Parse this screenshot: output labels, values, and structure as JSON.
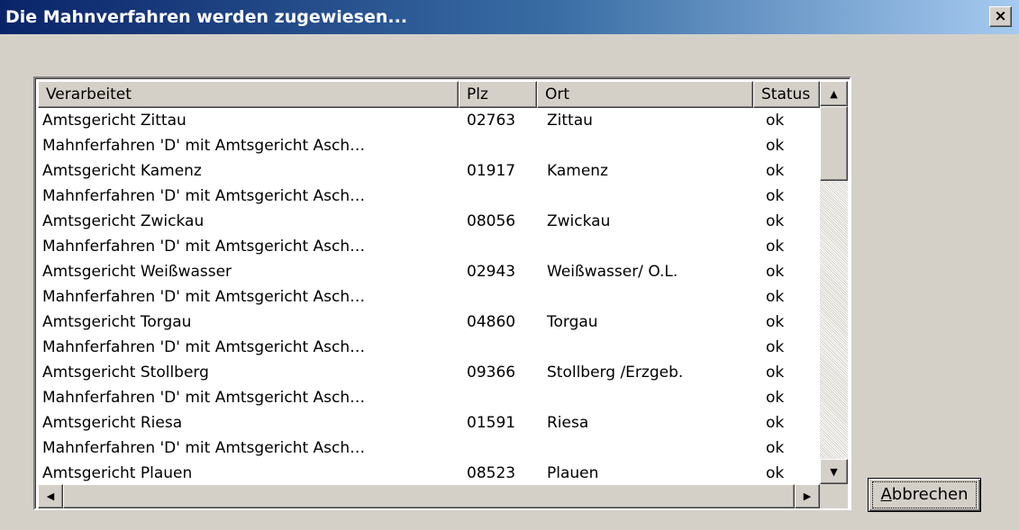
{
  "window": {
    "title": "Die Mahnverfahren werden zugewiesen...",
    "close_label": "×"
  },
  "columns": [
    "Verarbeitet",
    "Plz",
    "Ort",
    "Status"
  ],
  "rows": [
    {
      "verarbeitet": "Amtsgericht Zittau",
      "plz": "02763",
      "ort": "Zittau",
      "status": "ok"
    },
    {
      "verarbeitet": "Mahnferfahren 'D' mit Amtsgericht Asch…",
      "plz": "",
      "ort": "",
      "status": "ok"
    },
    {
      "verarbeitet": "Amtsgericht Kamenz",
      "plz": "01917",
      "ort": "Kamenz",
      "status": "ok"
    },
    {
      "verarbeitet": "Mahnferfahren 'D' mit Amtsgericht Asch…",
      "plz": "",
      "ort": "",
      "status": "ok"
    },
    {
      "verarbeitet": "Amtsgericht Zwickau",
      "plz": "08056",
      "ort": "Zwickau",
      "status": "ok"
    },
    {
      "verarbeitet": "Mahnferfahren 'D' mit Amtsgericht Asch…",
      "plz": "",
      "ort": "",
      "status": "ok"
    },
    {
      "verarbeitet": "Amtsgericht Weißwasser",
      "plz": "02943",
      "ort": "Weißwasser/ O.L.",
      "status": "ok"
    },
    {
      "verarbeitet": "Mahnferfahren 'D' mit Amtsgericht Asch…",
      "plz": "",
      "ort": "",
      "status": "ok"
    },
    {
      "verarbeitet": "Amtsgericht Torgau",
      "plz": "04860",
      "ort": "Torgau",
      "status": "ok"
    },
    {
      "verarbeitet": "Mahnferfahren 'D' mit Amtsgericht Asch…",
      "plz": "",
      "ort": "",
      "status": "ok"
    },
    {
      "verarbeitet": "Amtsgericht Stollberg",
      "plz": "09366",
      "ort": "Stollberg /Erzgeb.",
      "status": "ok"
    },
    {
      "verarbeitet": "Mahnferfahren 'D' mit Amtsgericht Asch…",
      "plz": "",
      "ort": "",
      "status": "ok"
    },
    {
      "verarbeitet": "Amtsgericht Riesa",
      "plz": "01591",
      "ort": "Riesa",
      "status": "ok"
    },
    {
      "verarbeitet": "Mahnferfahren 'D' mit Amtsgericht Asch…",
      "plz": "",
      "ort": "",
      "status": "ok"
    },
    {
      "verarbeitet": "Amtsgericht Plauen",
      "plz": "08523",
      "ort": "Plauen",
      "status": "ok"
    }
  ],
  "scrollbar": {
    "up_icon": "▲",
    "down_icon": "▼",
    "left_icon": "◀",
    "right_icon": "▶"
  },
  "buttons": {
    "abort_accel": "A",
    "abort_rest": "bbrechen"
  }
}
